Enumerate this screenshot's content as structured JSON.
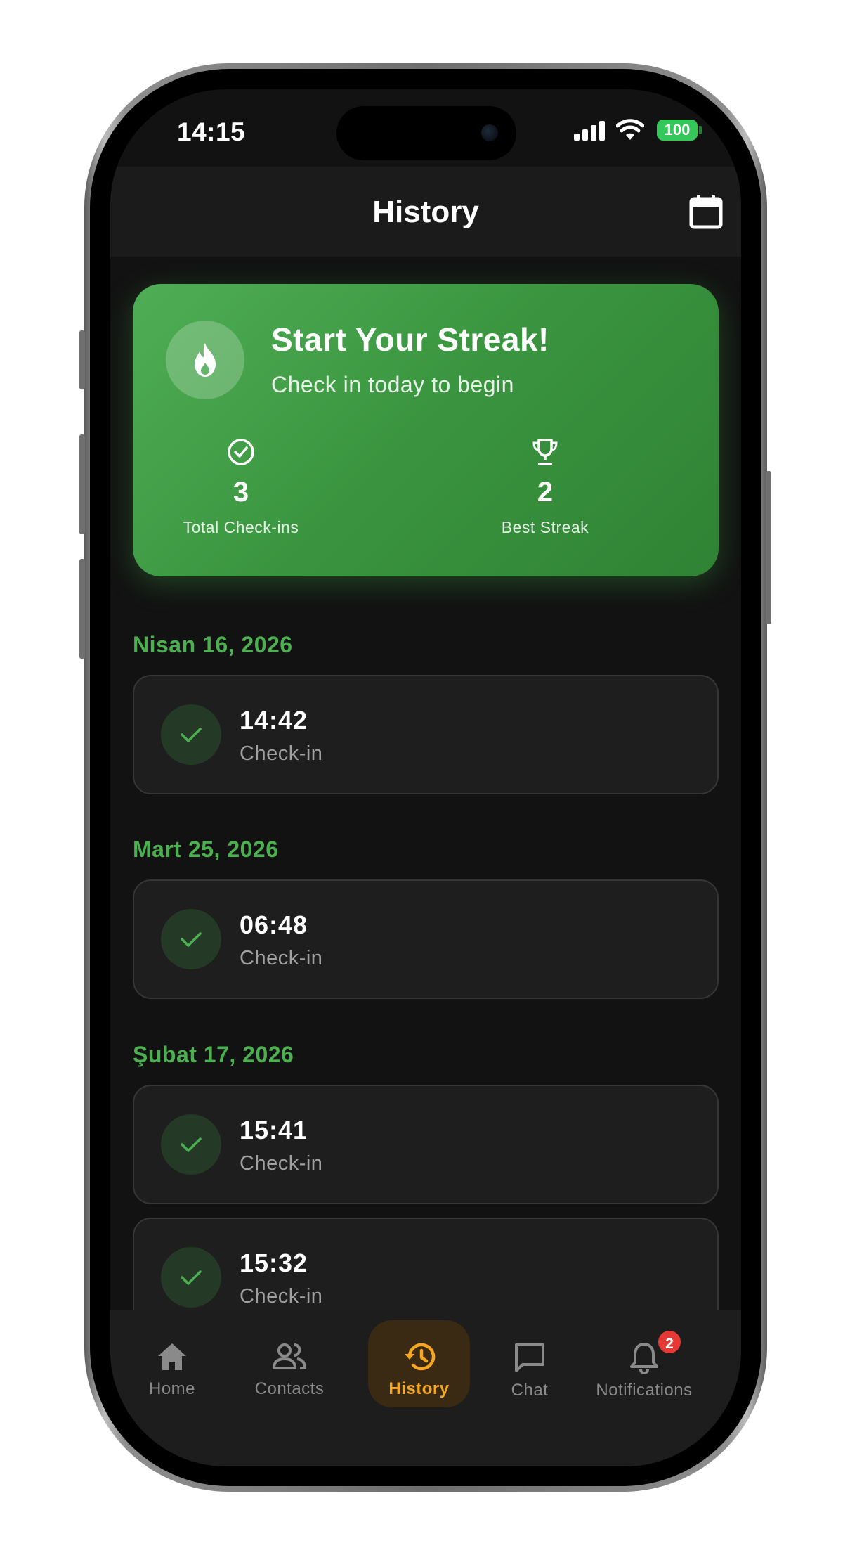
{
  "status_bar": {
    "time": "14:15",
    "battery": "100"
  },
  "header": {
    "title": "History",
    "calendar_icon": "calendar-icon"
  },
  "streak_card": {
    "title": "Start Your Streak!",
    "subtitle": "Check in today to begin",
    "icon": "fire-icon",
    "stats": [
      {
        "icon": "check-circle-icon",
        "value": "3",
        "label": "Total Check-ins"
      },
      {
        "icon": "trophy-icon",
        "value": "2",
        "label": "Best Streak"
      }
    ]
  },
  "groups": [
    {
      "date": "Nisan 16, 2026",
      "entries": [
        {
          "time": "14:42",
          "label": "Check-in"
        }
      ]
    },
    {
      "date": "Mart 25, 2026",
      "entries": [
        {
          "time": "06:48",
          "label": "Check-in"
        }
      ]
    },
    {
      "date": "Şubat 17, 2026",
      "entries": [
        {
          "time": "15:41",
          "label": "Check-in"
        },
        {
          "time": "15:32",
          "label": "Check-in"
        }
      ]
    }
  ],
  "nav": {
    "items": [
      {
        "label": "Home",
        "icon": "home-icon"
      },
      {
        "label": "Contacts",
        "icon": "contacts-icon"
      },
      {
        "label": "History",
        "icon": "history-icon",
        "active": true
      },
      {
        "label": "Chat",
        "icon": "chat-icon"
      },
      {
        "label": "Notifications",
        "icon": "bell-icon",
        "badge": "2"
      }
    ]
  },
  "colors": {
    "accent_green": "#4caf50",
    "active_nav": "#f5a623",
    "badge_red": "#e53935",
    "background": "#121212"
  }
}
